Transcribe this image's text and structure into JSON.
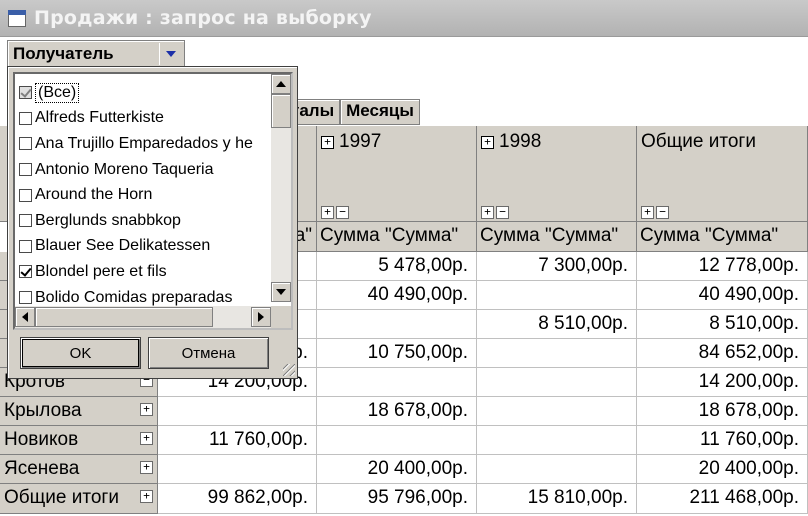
{
  "window": {
    "title": "Продажи : запрос на выборку"
  },
  "filter": {
    "field_label": "Получатель"
  },
  "column_fields": {
    "clipped_label": "талы",
    "months_label": "Месяцы"
  },
  "pivot": {
    "years": [
      "1997",
      "1998"
    ],
    "grand_total_label": "Общие итоги",
    "measure_label": "Сумма \"Сумма\"",
    "clipped_measure_label": "а\"",
    "expand_symbol": "+",
    "collapse_symbol": "−",
    "year_plus_symbol": "+",
    "rows": [
      {
        "label": "",
        "c0": "",
        "c1": "5 478,00р.",
        "c2": "7 300,00р.",
        "total": "12 778,00р."
      },
      {
        "label": "",
        "c0": "",
        "c1": "40 490,00р.",
        "c2": "",
        "total": "40 490,00р."
      },
      {
        "label": "",
        "c0": "",
        "c1": "",
        "c2": "8 510,00р.",
        "total": "8 510,00р."
      },
      {
        "label": "",
        "c0": "р.",
        "c1": "10 750,00р.",
        "c2": "",
        "total": "84 652,00р."
      },
      {
        "label": "Кротов",
        "c0": "14 200,00р.",
        "c1": "",
        "c2": "",
        "total": "14 200,00р."
      },
      {
        "label": "Крылова",
        "c0": "",
        "c1": "18 678,00р.",
        "c2": "",
        "total": "18 678,00р."
      },
      {
        "label": "Новиков",
        "c0": "11 760,00р.",
        "c1": "",
        "c2": "",
        "total": "11 760,00р."
      },
      {
        "label": "Ясенева",
        "c0": "",
        "c1": "20 400,00р.",
        "c2": "",
        "total": "20 400,00р."
      },
      {
        "label": "Общие итоги",
        "c0": "99 862,00р.",
        "c1": "95 796,00р.",
        "c2": "15 810,00р.",
        "total": "211 468,00р."
      }
    ]
  },
  "popup": {
    "items": [
      {
        "label": "(Все)",
        "checked": true,
        "disabled_look": true,
        "selected": true
      },
      {
        "label": "Alfreds Futterkiste",
        "checked": false
      },
      {
        "label": "Ana Trujillo Emparedados y he",
        "checked": false
      },
      {
        "label": "Antonio Moreno Taqueria",
        "checked": false
      },
      {
        "label": "Around the Horn",
        "checked": false
      },
      {
        "label": "Berglunds snabbkop",
        "checked": false
      },
      {
        "label": "Blauer See Delikatessen",
        "checked": false
      },
      {
        "label": "Blondel pere et fils",
        "checked": true
      },
      {
        "label": "Bolido Comidas preparadas",
        "checked": false
      }
    ],
    "ok_label": "OK",
    "cancel_label": "Отмена"
  }
}
